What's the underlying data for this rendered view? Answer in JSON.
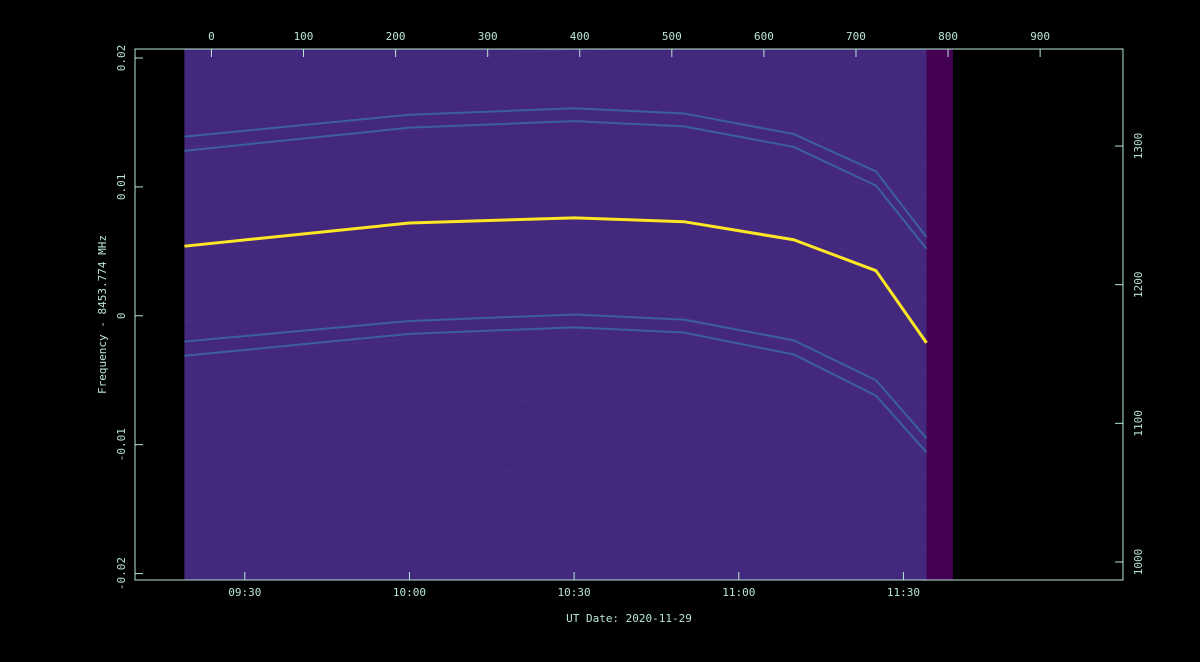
{
  "chart_data": {
    "type": "heatmap",
    "xlabel": "UT Date: 2020-11-29",
    "ylabel": "Frequency - 8453.774 MHz",
    "x_bottom_ticks": [
      "09:30",
      "10:00",
      "10:30",
      "11:00",
      "11:30"
    ],
    "x_bottom_tick_minutes": [
      570,
      600,
      630,
      660,
      690
    ],
    "x_bottom_range_minutes": [
      550,
      730
    ],
    "x_top_ticks": [
      "0",
      "100",
      "200",
      "300",
      "400",
      "500",
      "600",
      "700",
      "800",
      "900"
    ],
    "x_top_range": [
      -83,
      990
    ],
    "y_left_ticks": [
      "0.02",
      "0.01",
      "0",
      "-0.01",
      "-0.02"
    ],
    "y_left_tick_values": [
      0.02,
      0.01,
      0,
      -0.01,
      -0.02
    ],
    "y_left_range": [
      -0.0205,
      0.0207
    ],
    "y_right_ticks": [
      "1000",
      "1100",
      "1200",
      "1300"
    ],
    "y_right_range": [
      987,
      1370
    ],
    "data_extent_minutes": [
      559,
      694.2
    ],
    "padding_extent_minutes": [
      694.2,
      699
    ],
    "colormap": "viridis",
    "colors": {
      "background": "#000000",
      "frame": "#b9e6d2",
      "field": "#44287e",
      "padding": "#440154",
      "carrier": "#fde725",
      "sideband": "#3b6aa0"
    },
    "traces": [
      {
        "role": "carrier",
        "points": [
          [
            559,
            0.0054
          ],
          [
            600,
            0.0072
          ],
          [
            630,
            0.0076
          ],
          [
            650,
            0.0073
          ],
          [
            670,
            0.0059
          ],
          [
            685,
            0.0035
          ],
          [
            694.2,
            -0.0021
          ]
        ]
      },
      {
        "role": "sideband",
        "points": [
          [
            559,
            0.0139
          ],
          [
            600,
            0.0156
          ],
          [
            630,
            0.0161
          ],
          [
            650,
            0.0157
          ],
          [
            670,
            0.0141
          ],
          [
            685,
            0.0112
          ],
          [
            694.2,
            0.0061
          ]
        ]
      },
      {
        "role": "sideband",
        "points": [
          [
            559,
            0.0128
          ],
          [
            600,
            0.0146
          ],
          [
            630,
            0.0151
          ],
          [
            650,
            0.0147
          ],
          [
            670,
            0.0131
          ],
          [
            685,
            0.0101
          ],
          [
            694.2,
            0.0052
          ]
        ]
      },
      {
        "role": "sideband",
        "points": [
          [
            559,
            -0.002
          ],
          [
            600,
            -0.0004
          ],
          [
            630,
            0.0001
          ],
          [
            650,
            -0.0003
          ],
          [
            670,
            -0.0019
          ],
          [
            685,
            -0.005
          ],
          [
            694.2,
            -0.0095
          ]
        ]
      },
      {
        "role": "sideband",
        "points": [
          [
            559,
            -0.0031
          ],
          [
            600,
            -0.0014
          ],
          [
            630,
            -0.0009
          ],
          [
            650,
            -0.0013
          ],
          [
            670,
            -0.003
          ],
          [
            685,
            -0.0062
          ],
          [
            694.2,
            -0.0106
          ]
        ]
      }
    ]
  }
}
